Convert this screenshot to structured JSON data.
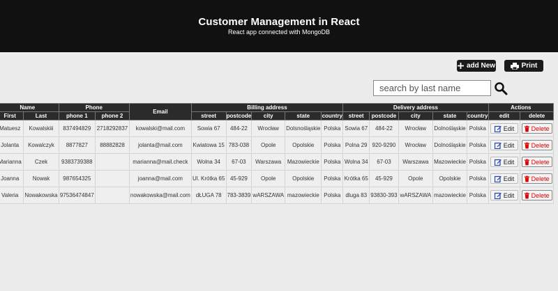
{
  "header": {
    "title": "Customer Management in React",
    "subtitle": "React app connected with MongoDB"
  },
  "toolbar": {
    "add_label": "add New",
    "add_icon": "plus-icon",
    "print_label": "Print",
    "print_icon": "printer-icon"
  },
  "search": {
    "placeholder": "search by last name",
    "value": "",
    "icon": "search-icon"
  },
  "table": {
    "group_headers": {
      "name": "Name",
      "phone": "Phone",
      "email": "Email",
      "billing": "Billing address",
      "delivery": "Delivery address",
      "actions": "Actions"
    },
    "sub_headers": {
      "first": "First",
      "last": "Last",
      "phone1": "phone 1",
      "phone2": "phone 2",
      "b_street": "street",
      "b_postcode": "postcode",
      "b_city": "city",
      "b_state": "state",
      "b_country": "country",
      "d_street": "street",
      "d_postcode": "postcode",
      "d_city": "city",
      "d_state": "state",
      "d_country": "country",
      "edit": "edit",
      "delete": "delete"
    },
    "edit_label": "Edit",
    "delete_label": "Delete",
    "colors": {
      "delete": "#e00000",
      "edit_icon": "#1f3fb5"
    },
    "rows": [
      {
        "first": "Matuesz",
        "last": "Kowalskiii",
        "phone1": "837494829",
        "phone2": "2718292837",
        "email": "kowalski@mail.com",
        "b_street": "Sowia 67",
        "b_postcode": "484-22",
        "b_city": "Wrocław",
        "b_state": "Dolsnośląskie",
        "b_country": "Polska",
        "d_street": "Sowia 67",
        "d_postcode": "484-22",
        "d_city": "Wrocław",
        "d_state": "Dolnośląskie",
        "d_country": "Polska"
      },
      {
        "first": "Jolanta",
        "last": "Kowalczyk",
        "phone1": "8877827",
        "phone2": "88882828",
        "email": "jolanta@mail.com",
        "b_street": "Kwiatowa 15",
        "b_postcode": "783-038",
        "b_city": "Opole",
        "b_state": "Opolskie",
        "b_country": "Polska",
        "d_street": "Polna 29",
        "d_postcode": "920-9290",
        "d_city": "Wrocław",
        "d_state": "Dolnośląskie",
        "d_country": "Polska"
      },
      {
        "first": "Marianna",
        "last": "Czek",
        "phone1": "9383739388",
        "phone2": "",
        "email": "marianna@mail.check",
        "b_street": "Wolna 34",
        "b_postcode": "67-03",
        "b_city": "Warszawa",
        "b_state": "Mazowieckie",
        "b_country": "Polska",
        "d_street": "Wolna 34",
        "d_postcode": "67-03",
        "d_city": "Warszawa",
        "d_state": "Mazowieckie",
        "d_country": "Polska"
      },
      {
        "first": "Joanna",
        "last": "Nowak",
        "phone1": "987654325",
        "phone2": "",
        "email": "joanna@mail.com",
        "b_street": "Ul. Krótka 65",
        "b_postcode": "45-929",
        "b_city": "Opole",
        "b_state": "Opolskie",
        "b_country": "Polska",
        "d_street": "Krótka 65",
        "d_postcode": "45-929",
        "d_city": "Opole",
        "d_state": "Opolskie",
        "d_country": "Polska"
      },
      {
        "first": "Valeria",
        "last": "Nowakowska",
        "phone1": "97536474847",
        "phone2": "",
        "email": "nowakowska@mail.com",
        "b_street": "dŁUGA 78",
        "b_postcode": "783-3839",
        "b_city": "wARSZAWA",
        "b_state": "mazowieckie",
        "b_country": "Polska",
        "d_street": "dluga 83",
        "d_postcode": "93830-393",
        "d_city": "wARSZAWA",
        "d_state": "mazowieckie",
        "d_country": "Polska"
      }
    ]
  }
}
